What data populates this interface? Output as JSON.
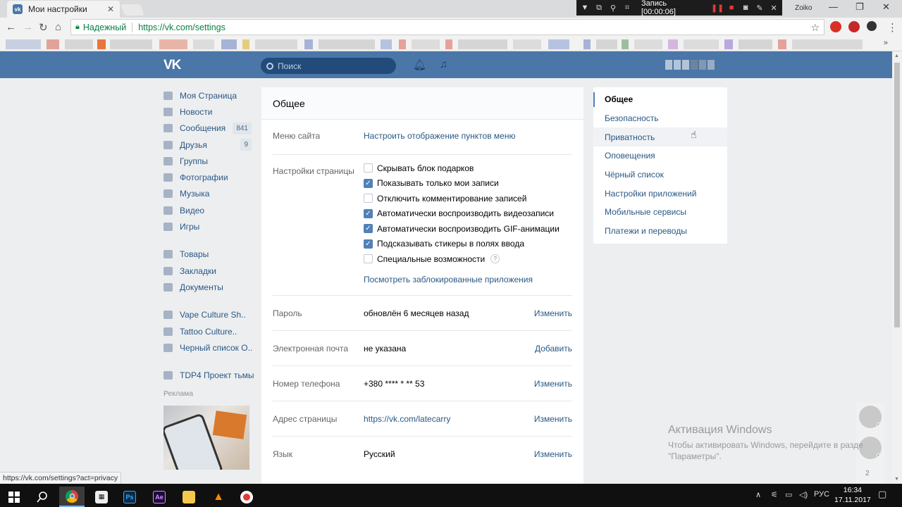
{
  "browser": {
    "tab_title": "Мои настройки",
    "tab_close": "✕",
    "secure_label": "Надежный",
    "url": "https://vk.com/settings",
    "profile_name": "Zoiko",
    "status_url": "https://vk.com/settings?act=privacy",
    "recorder": {
      "label": "Запись [00:00:06]"
    }
  },
  "header": {
    "logo": "VK",
    "search_placeholder": "Поиск"
  },
  "left_nav": {
    "items": [
      {
        "label": "Моя Страница",
        "icon": "home-icon"
      },
      {
        "label": "Новости",
        "icon": "news-icon"
      },
      {
        "label": "Сообщения",
        "icon": "messages-icon",
        "count": "841"
      },
      {
        "label": "Друзья",
        "icon": "friends-icon",
        "count": "9"
      },
      {
        "label": "Группы",
        "icon": "groups-icon"
      },
      {
        "label": "Фотографии",
        "icon": "camera-icon"
      },
      {
        "label": "Музыка",
        "icon": "music-icon"
      },
      {
        "label": "Видео",
        "icon": "video-icon"
      },
      {
        "label": "Игры",
        "icon": "gamepad-icon"
      }
    ],
    "items2": [
      {
        "label": "Товары",
        "icon": "bag-icon"
      },
      {
        "label": "Закладки",
        "icon": "star-icon"
      },
      {
        "label": "Документы",
        "icon": "document-icon"
      }
    ],
    "groups": [
      {
        "label": "Vape Culture Sh..",
        "icon": "group-icon"
      },
      {
        "label": "Tattoo Culture..",
        "icon": "group-icon"
      },
      {
        "label": "Черный список О..",
        "icon": "group-icon"
      }
    ],
    "apps": [
      {
        "label": "TDP4 Проект тьмы",
        "icon": "app-icon"
      }
    ],
    "ads_label": "Реклама"
  },
  "main": {
    "title": "Общее",
    "site_menu": {
      "label": "Меню сайта",
      "link": "Настроить отображение пунктов меню"
    },
    "page_settings": {
      "label": "Настройки страницы",
      "checkboxes": [
        {
          "label": "Скрывать блок подарков",
          "checked": false
        },
        {
          "label": "Показывать только мои записи",
          "checked": true
        },
        {
          "label": "Отключить комментирование записей",
          "checked": false
        },
        {
          "label": "Автоматически воспроизводить видеозаписи",
          "checked": true
        },
        {
          "label": "Автоматически воспроизводить GIF-анимации",
          "checked": true
        },
        {
          "label": "Подсказывать стикеры в полях ввода",
          "checked": true
        },
        {
          "label": "Специальные возможности",
          "checked": false,
          "help": "?"
        }
      ],
      "blocked_apps_link": "Посмотреть заблокированные приложения"
    },
    "rows": [
      {
        "label": "Пароль",
        "value": "обновлён 6 месяцев назад",
        "action": "Изменить"
      },
      {
        "label": "Электронная почта",
        "value": "не указана",
        "action": "Добавить"
      },
      {
        "label": "Номер телефона",
        "value": "+380 **** * ** 53",
        "action": "Изменить"
      },
      {
        "label": "Адрес страницы",
        "value": "https://vk.com/latecarry",
        "action": "Изменить"
      },
      {
        "label": "Язык",
        "value": "Русский",
        "action": "Изменить"
      }
    ]
  },
  "right_menu": {
    "items": [
      {
        "label": "Общее",
        "active": true
      },
      {
        "label": "Безопасность"
      },
      {
        "label": "Приватность",
        "hover": true
      },
      {
        "label": "Оповещения"
      },
      {
        "label": "Чёрный список"
      },
      {
        "label": "Настройки приложений"
      },
      {
        "label": "Мобильные сервисы"
      },
      {
        "label": "Платежи и переводы"
      }
    ]
  },
  "friends_online_count": "2",
  "watermark": {
    "title": "Активация Windows",
    "line1": "Чтобы активировать Windows, перейдите в разде",
    "line2": "\"Параметры\"."
  },
  "taskbar": {
    "lang": "РУС",
    "time": "16:34",
    "date": "17.11.2017"
  },
  "colors": {
    "vk_blue": "#4a76a8",
    "link": "#2a5885",
    "checkbox_on": "#5181b8"
  }
}
